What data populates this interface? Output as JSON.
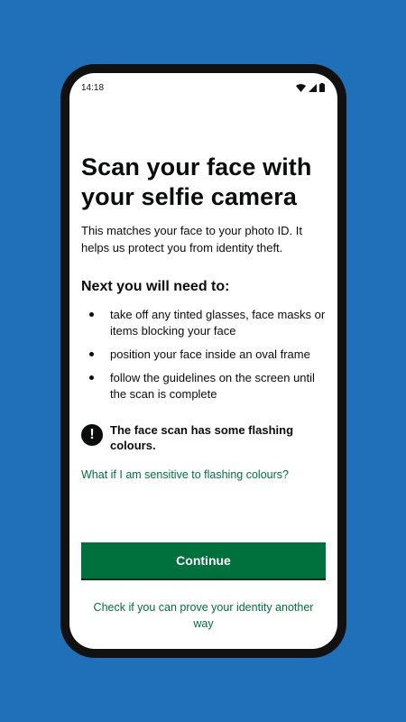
{
  "status_bar": {
    "time": "14:18",
    "icons": [
      "wifi-icon",
      "signal-icon",
      "battery-icon"
    ]
  },
  "page": {
    "title": "Scan your face with your selfie camera",
    "intro": "This matches your face to your photo ID. It helps us protect you from identity theft.",
    "subheading": "Next you will need to:",
    "bullets": [
      "take off any tinted glasses, face masks or items blocking your face",
      "position your face inside an oval  frame",
      "follow the guidelines on the screen until the scan is complete"
    ],
    "warning": {
      "icon": "!",
      "text": "The face scan has some flashing colours."
    },
    "sensitive_link": "What if I am sensitive to flashing colours?",
    "continue_label": "Continue",
    "alt_link": "Check if you can prove your identity another way"
  },
  "colors": {
    "background": "#1f70b8",
    "primary_green": "#00703c",
    "text": "#0b0c0c"
  }
}
